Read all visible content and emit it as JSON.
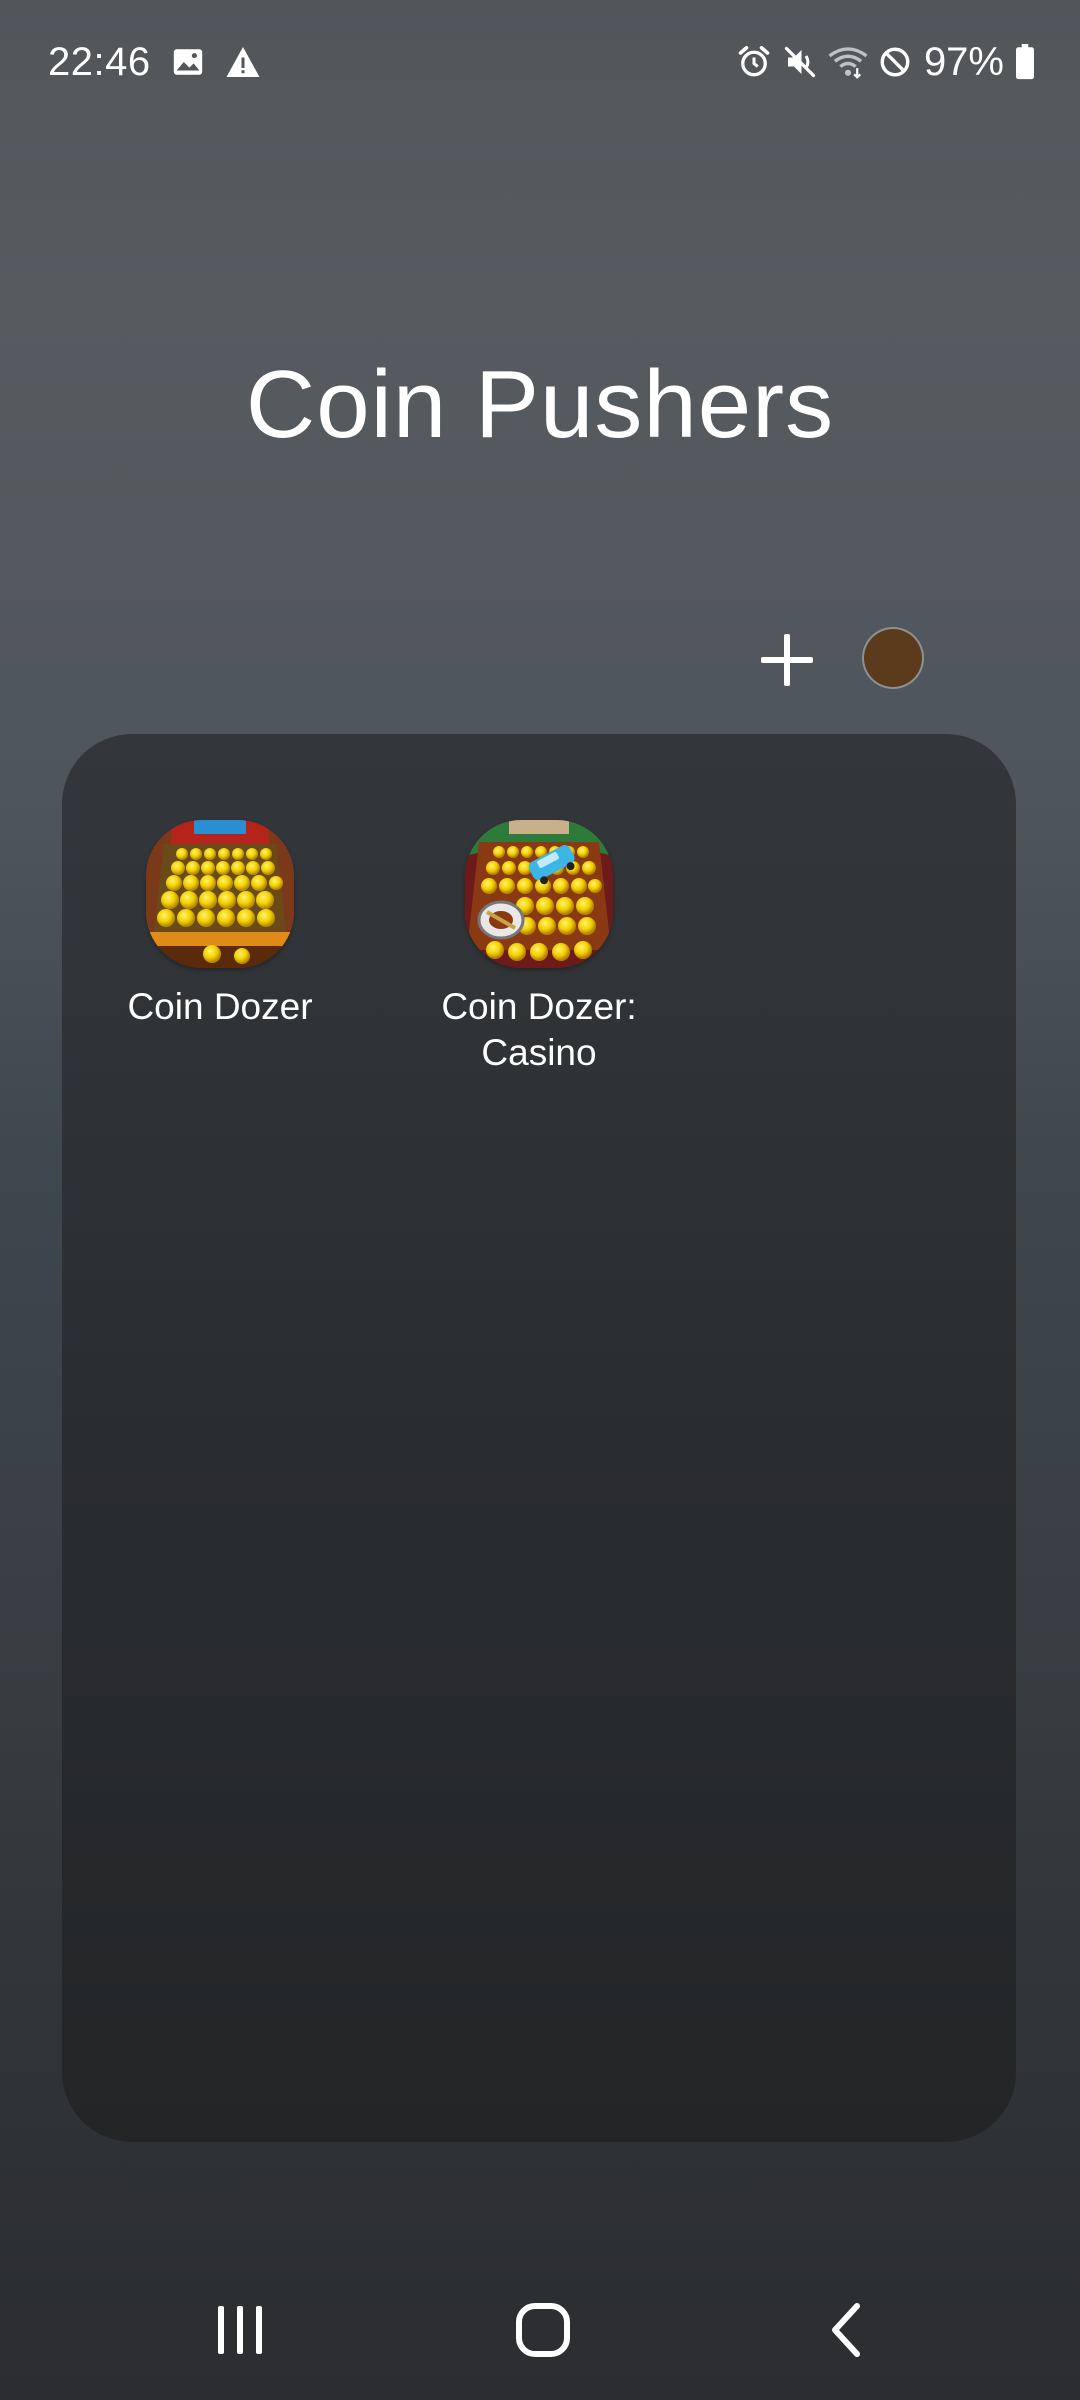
{
  "status_bar": {
    "time": "22:46",
    "left_icons": [
      "image-icon",
      "warning-icon"
    ],
    "right_icons": [
      "alarm-icon",
      "mute-icon",
      "wifi-icon",
      "do-not-disturb-icon",
      "battery-icon"
    ],
    "battery_text": "97%"
  },
  "folder": {
    "title": "Coin Pushers",
    "color": "#5b3b1c",
    "apps": [
      {
        "label": "Coin Dozer",
        "icon": "coin-dozer-icon"
      },
      {
        "label": "Coin Dozer:\nCasino",
        "icon": "coin-dozer-casino-icon"
      }
    ]
  },
  "actions": {
    "add_icon": "plus-icon",
    "color_picker": "folder-color-button"
  },
  "nav_bar": {
    "recents_icon": "recents-icon",
    "home_icon": "home-icon",
    "back_icon": "back-icon"
  }
}
